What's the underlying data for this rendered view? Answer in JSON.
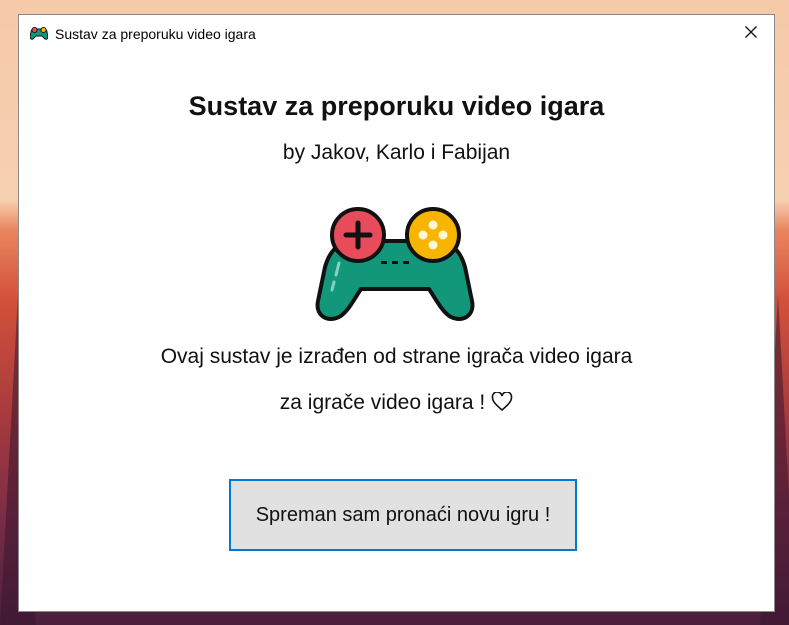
{
  "window": {
    "title": "Sustav za preporuku video igara",
    "app_icon": "gamepad-icon",
    "close_icon": "close-icon"
  },
  "content": {
    "heading": "Sustav za preporuku video igara",
    "authors": "by Jakov, Karlo i Fabijan",
    "illustration": "game-controller-icon",
    "description_line1": "Ovaj sustav je izrađen od strane igrača video igara",
    "description_line2": "za igrače video igara !",
    "heart_icon": "heart-outline-icon",
    "start_button_label": "Spreman sam pronaći novu igru !"
  },
  "colors": {
    "button_border": "#0078d7",
    "button_bg": "#e1e1e1",
    "controller_body": "#13977a",
    "controller_red": "#e84c5a",
    "controller_yellow": "#f7b500"
  }
}
